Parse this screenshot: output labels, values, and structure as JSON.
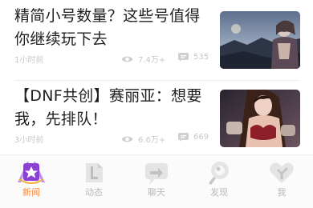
{
  "feed": [
    {
      "title": "精简小号数量？这些号值得你继续玩下去",
      "time": "1小时前",
      "views": "7.4万+",
      "comments": "535"
    },
    {
      "title": "【DNF共创】赛丽亚：想要我，先排队！",
      "time": "3小时前",
      "views": "6.6万+",
      "comments": "669"
    }
  ],
  "tabs": [
    {
      "label": "新闻",
      "icon": "news-icon",
      "active": true
    },
    {
      "label": "动态",
      "icon": "activity-icon",
      "active": false
    },
    {
      "label": "聊天",
      "icon": "chat-icon",
      "active": false
    },
    {
      "label": "发现",
      "icon": "discover-icon",
      "active": false
    },
    {
      "label": "我",
      "icon": "profile-icon",
      "active": false
    }
  ],
  "colors": {
    "accent": "#ff8a3d",
    "accent_purple": "#8a3fd6",
    "inactive": "#bcbcbc"
  }
}
